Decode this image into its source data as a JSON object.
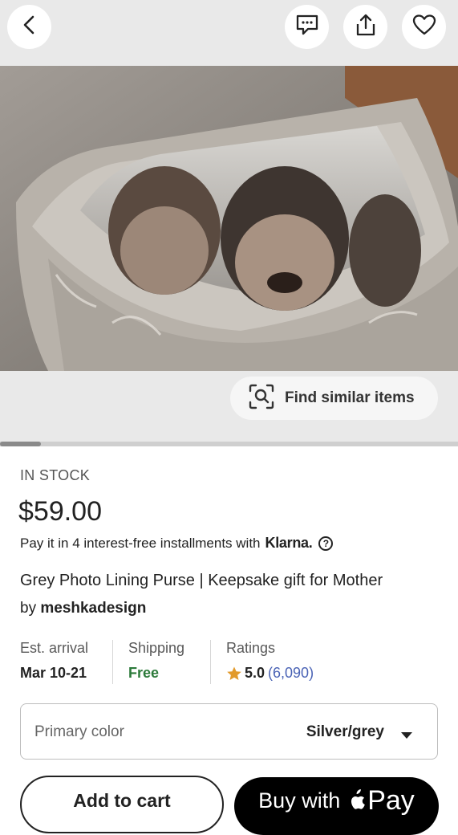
{
  "colors": {
    "accent_green": "#2c7a3a",
    "star": "#e29a2b",
    "link_blue": "#4a63b5"
  },
  "topbar": {
    "back_icon": "chevron-left-icon",
    "message_icon": "message-icon",
    "share_icon": "share-icon",
    "favorite_icon": "heart-icon"
  },
  "gallery": {
    "find_similar_label": "Find similar items",
    "scroll_position": 0.09
  },
  "listing": {
    "stock": "IN STOCK",
    "price": "$59.00",
    "installments_text": "Pay it in 4 interest-free installments with",
    "klarna_brand": "Klarna.",
    "help_symbol": "?",
    "title": "Grey Photo Lining Purse | Keepsake gift for Mother",
    "by_prefix": "by",
    "shop_name": "meshkadesign"
  },
  "info": {
    "arrival_label": "Est. arrival",
    "arrival_value": "Mar 10-21",
    "shipping_label": "Shipping",
    "shipping_value": "Free",
    "ratings_label": "Ratings",
    "ratings_value": "5.0",
    "ratings_count": "(6,090)"
  },
  "variation": {
    "label": "Primary color",
    "selected": "Silver/grey"
  },
  "actions": {
    "add_to_cart": "Add to cart",
    "buy_with": "Buy with",
    "pay": "Pay"
  }
}
